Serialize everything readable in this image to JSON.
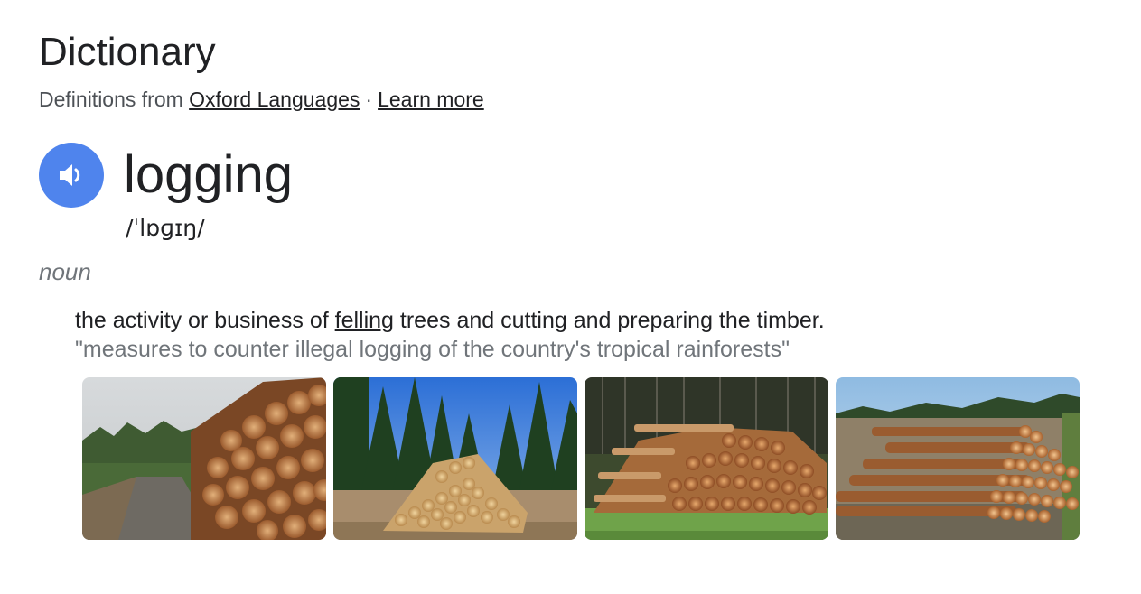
{
  "header": {
    "title": "Dictionary",
    "source_prefix": "Definitions from",
    "source_link": "Oxford Languages",
    "separator": "·",
    "learn_more": "Learn more"
  },
  "entry": {
    "word": "logging",
    "phonetic": "/ˈlɒɡɪŋ/",
    "part_of_speech": "noun",
    "definition": {
      "before": "the activity or business of ",
      "link": "felling",
      "after": " trees and cutting and preparing the timber."
    },
    "example": "\"measures to counter illegal logging of the country's tropical rainforests\""
  },
  "images": [
    {
      "icon": "log-pile-road-photo"
    },
    {
      "icon": "log-pile-forest-photo"
    },
    {
      "icon": "log-stack-field-photo"
    },
    {
      "icon": "log-stack-clearing-photo"
    }
  ],
  "colors": {
    "speaker_button": "#4f84ed",
    "text_primary": "#202124",
    "text_secondary": "#70757a"
  }
}
